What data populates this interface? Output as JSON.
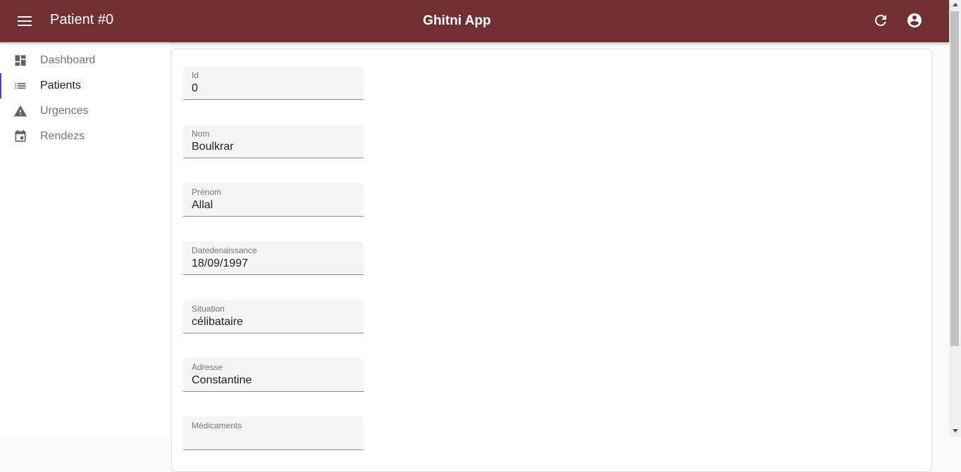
{
  "header": {
    "page_title": "Patient #0",
    "app_title": "Ghitni App",
    "icons": [
      "menu-icon",
      "refresh-icon",
      "account-circle-icon"
    ]
  },
  "sidebar": {
    "items": [
      {
        "label": "Dashboard",
        "icon": "dashboard-icon",
        "active": false
      },
      {
        "label": "Patients",
        "icon": "list-icon",
        "active": true
      },
      {
        "label": "Urgences",
        "icon": "warning-icon",
        "active": false
      },
      {
        "label": "Rendezs",
        "icon": "calendar-icon",
        "active": false
      }
    ]
  },
  "form": {
    "fields": [
      {
        "label": "Id",
        "value": "0"
      },
      {
        "label": "Nom",
        "value": "Boulkrar"
      },
      {
        "label": "Prénom",
        "value": "Allal"
      },
      {
        "label": "Datedenaissance",
        "value": "18/09/1997"
      },
      {
        "label": "Situation",
        "value": "célibataire"
      },
      {
        "label": "Adresse",
        "value": "Constantine"
      },
      {
        "label": "Médicaments",
        "value": ""
      }
    ]
  },
  "colors": {
    "appbar": "#722f30",
    "active_indicator": "#3f51b5",
    "field_background": "#f5f5f5"
  }
}
